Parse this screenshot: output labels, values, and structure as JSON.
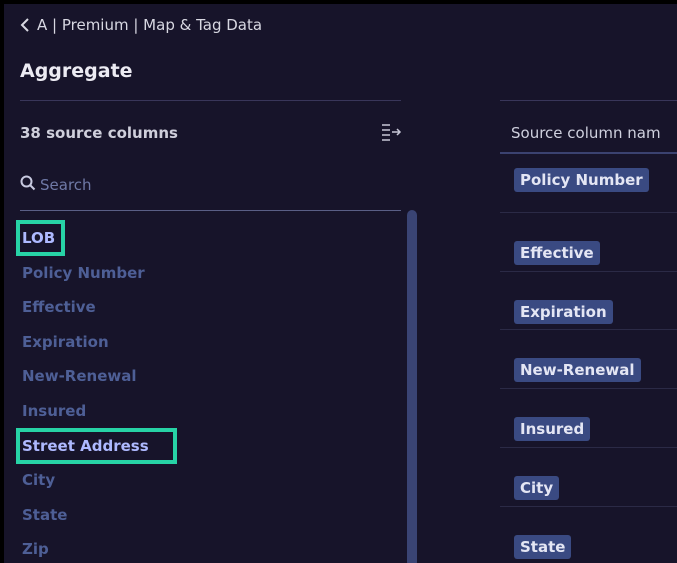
{
  "header": {
    "breadcrumb": "A | Premium | Map & Tag Data",
    "title": "Aggregate"
  },
  "sidebar": {
    "count": "38",
    "count_suffix": "source columns",
    "search_placeholder": "Search",
    "items": [
      {
        "label": "LOB"
      },
      {
        "label": "Policy Number"
      },
      {
        "label": "Effective"
      },
      {
        "label": "Expiration"
      },
      {
        "label": "New-Renewal"
      },
      {
        "label": "Insured"
      },
      {
        "label": "Street Address"
      },
      {
        "label": "City"
      },
      {
        "label": "State"
      },
      {
        "label": "Zip"
      }
    ]
  },
  "table": {
    "header": "Source column nam",
    "rows": [
      {
        "tag": "Policy Number"
      },
      {
        "tag": "Effective"
      },
      {
        "tag": "Expiration"
      },
      {
        "tag": "New-Renewal"
      },
      {
        "tag": "Insured"
      },
      {
        "tag": "City"
      },
      {
        "tag": "State"
      }
    ]
  },
  "colors": {
    "background": "#17142a",
    "highlight": "#27d3a6",
    "tag": "#3a4a82",
    "item_text": "#4e5f96",
    "item_selected": "#aeb9ff"
  },
  "icons": {
    "back": "chevron-left-icon",
    "collapse": "collapse-panel-icon",
    "search": "search-icon"
  }
}
